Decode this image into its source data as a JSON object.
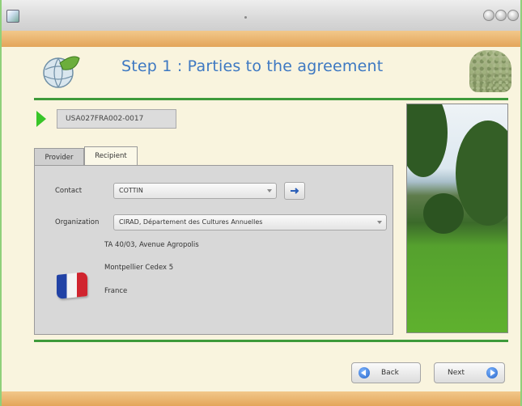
{
  "header": {
    "title": "Step 1 : Parties to the agreement"
  },
  "agreement": {
    "code": "USA027FRA002-0017"
  },
  "tabs": [
    {
      "label": "Provider"
    },
    {
      "label": "Recipient"
    }
  ],
  "recipient": {
    "contact_label": "Contact",
    "contact_value": "COTTIN",
    "organization_label": "Organization",
    "organization_value": "CIRAD, Département des Cultures Annuelles",
    "address_lines": [
      "TA 40/03, Avenue Agropolis",
      "Montpellier Cedex 5",
      "France"
    ]
  },
  "navigation": {
    "back_label": "Back",
    "next_label": "Next"
  },
  "colors": {
    "title_blue": "#3d78c2",
    "rule_green": "#3e9a3b",
    "orange_bar": "#e3a55a",
    "play_green": "#38c528"
  },
  "icons": {
    "app": "app-icon",
    "logo": "globe-leaf-logo",
    "seeds": "seed-pile-icon",
    "play": "play-icon",
    "flag": "france-flag-icon",
    "back": "arrow-left-icon",
    "next": "arrow-right-icon"
  }
}
